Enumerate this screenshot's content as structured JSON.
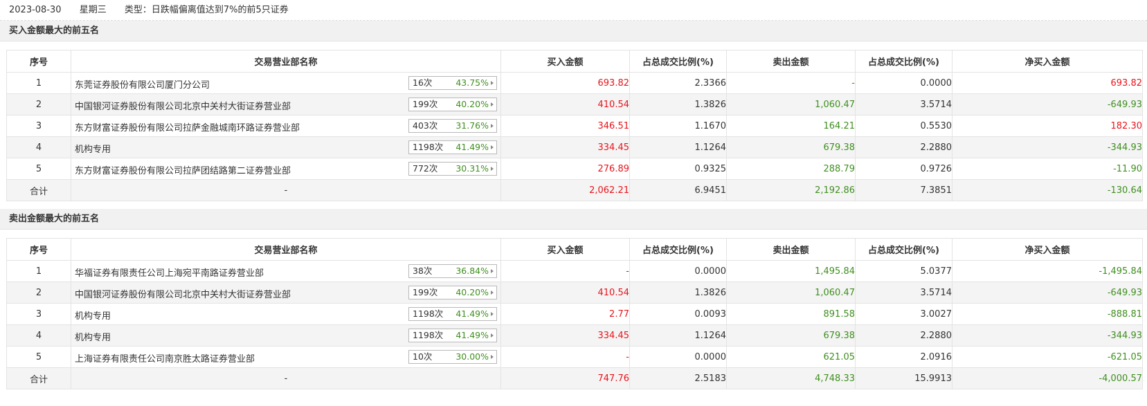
{
  "header": {
    "date": "2023-08-30",
    "weekday": "星期三",
    "type_text": "类型：日跌幅偏离值达到7%的前5只证券"
  },
  "columns": [
    "序号",
    "交易营业部名称",
    "买入金额",
    "占总成交比例(%)",
    "卖出金额",
    "占总成交比例(%)",
    "净买入金额"
  ],
  "colors": {
    "up": "#e8141b",
    "down": "#3f8f1f",
    "neutral": "#333333",
    "header_bg": "#f1f1f1",
    "alt_row": "#f4f4f4"
  },
  "sections": [
    {
      "title": "买入金额最大的前五名",
      "rows": [
        {
          "no": "1",
          "name": "东莞证券股份有限公司厦门分公司",
          "count": "16次",
          "pct": "43.75%",
          "buy": "693.82",
          "buy_color": "red",
          "buy_ratio": "2.3366",
          "sell": "-",
          "sell_color": "green",
          "sell_ratio": "0.0000",
          "net": "693.82",
          "net_color": "red"
        },
        {
          "no": "2",
          "name": "中国银河证券股份有限公司北京中关村大街证券营业部",
          "count": "199次",
          "pct": "40.20%",
          "buy": "410.54",
          "buy_color": "red",
          "buy_ratio": "1.3826",
          "sell": "1,060.47",
          "sell_color": "green",
          "sell_ratio": "3.5714",
          "net": "-649.93",
          "net_color": "green"
        },
        {
          "no": "3",
          "name": "东方财富证券股份有限公司拉萨金融城南环路证券营业部",
          "count": "403次",
          "pct": "31.76%",
          "buy": "346.51",
          "buy_color": "red",
          "buy_ratio": "1.1670",
          "sell": "164.21",
          "sell_color": "green",
          "sell_ratio": "0.5530",
          "net": "182.30",
          "net_color": "red"
        },
        {
          "no": "4",
          "name": "机构专用",
          "count": "1198次",
          "pct": "41.49%",
          "buy": "334.45",
          "buy_color": "red",
          "buy_ratio": "1.1264",
          "sell": "679.38",
          "sell_color": "green",
          "sell_ratio": "2.2880",
          "net": "-344.93",
          "net_color": "green"
        },
        {
          "no": "5",
          "name": "东方财富证券股份有限公司拉萨团结路第二证券营业部",
          "count": "772次",
          "pct": "30.31%",
          "buy": "276.89",
          "buy_color": "red",
          "buy_ratio": "0.9325",
          "sell": "288.79",
          "sell_color": "green",
          "sell_ratio": "0.9726",
          "net": "-11.90",
          "net_color": "green"
        }
      ],
      "total": {
        "label": "合计",
        "name": "-",
        "buy": "2,062.21",
        "buy_color": "red",
        "buy_ratio": "6.9451",
        "sell": "2,192.86",
        "sell_color": "green",
        "sell_ratio": "7.3851",
        "net": "-130.64",
        "net_color": "green"
      }
    },
    {
      "title": "卖出金额最大的前五名",
      "rows": [
        {
          "no": "1",
          "name": "华福证券有限责任公司上海宛平南路证券营业部",
          "count": "38次",
          "pct": "36.84%",
          "buy": "-",
          "buy_color": "red",
          "buy_ratio": "0.0000",
          "sell": "1,495.84",
          "sell_color": "green",
          "sell_ratio": "5.0377",
          "net": "-1,495.84",
          "net_color": "green"
        },
        {
          "no": "2",
          "name": "中国银河证券股份有限公司北京中关村大街证券营业部",
          "count": "199次",
          "pct": "40.20%",
          "buy": "410.54",
          "buy_color": "red",
          "buy_ratio": "1.3826",
          "sell": "1,060.47",
          "sell_color": "green",
          "sell_ratio": "3.5714",
          "net": "-649.93",
          "net_color": "green"
        },
        {
          "no": "3",
          "name": "机构专用",
          "count": "1198次",
          "pct": "41.49%",
          "buy": "2.77",
          "buy_color": "red",
          "buy_ratio": "0.0093",
          "sell": "891.58",
          "sell_color": "green",
          "sell_ratio": "3.0027",
          "net": "-888.81",
          "net_color": "green"
        },
        {
          "no": "4",
          "name": "机构专用",
          "count": "1198次",
          "pct": "41.49%",
          "buy": "334.45",
          "buy_color": "red",
          "buy_ratio": "1.1264",
          "sell": "679.38",
          "sell_color": "green",
          "sell_ratio": "2.2880",
          "net": "-344.93",
          "net_color": "green"
        },
        {
          "no": "5",
          "name": "上海证券有限责任公司南京胜太路证券营业部",
          "count": "10次",
          "pct": "30.00%",
          "buy": "-",
          "buy_color": "red",
          "buy_ratio": "0.0000",
          "sell": "621.05",
          "sell_color": "green",
          "sell_ratio": "2.0916",
          "net": "-621.05",
          "net_color": "green"
        }
      ],
      "total": {
        "label": "合计",
        "name": "-",
        "buy": "747.76",
        "buy_color": "red",
        "buy_ratio": "2.5183",
        "sell": "4,748.33",
        "sell_color": "green",
        "sell_ratio": "15.9913",
        "net": "-4,000.57",
        "net_color": "green"
      }
    }
  ]
}
